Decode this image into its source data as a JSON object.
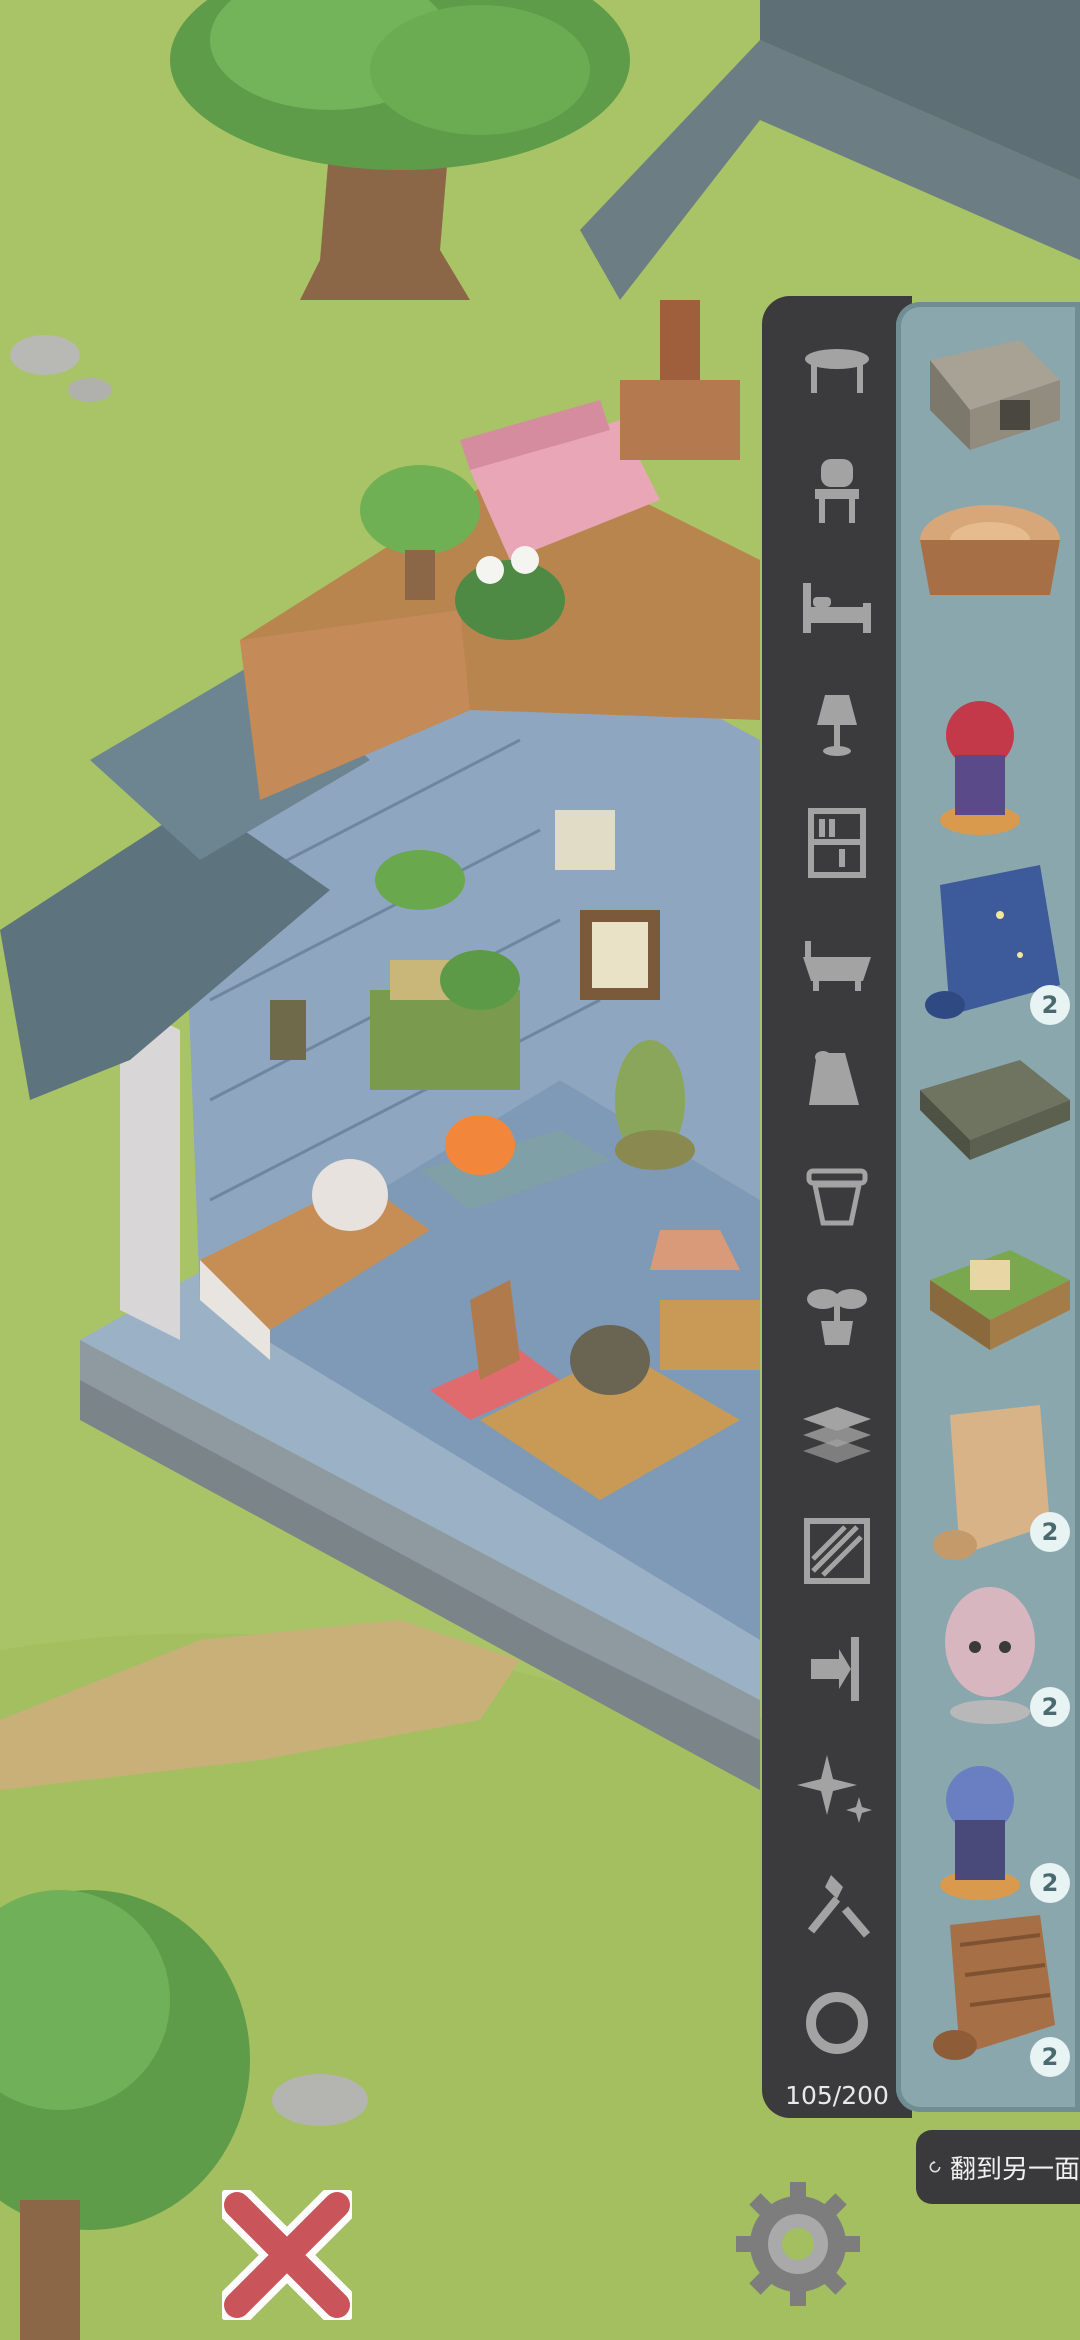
{
  "categories": [
    {
      "id": "table",
      "icon": "table-icon"
    },
    {
      "id": "chair",
      "icon": "chair-icon"
    },
    {
      "id": "bed",
      "icon": "bed-icon"
    },
    {
      "id": "lamp",
      "icon": "lamp-icon"
    },
    {
      "id": "shelf",
      "icon": "bookshelf-icon"
    },
    {
      "id": "bath",
      "icon": "bathtub-icon"
    },
    {
      "id": "rug",
      "icon": "rug-icon"
    },
    {
      "id": "pot",
      "icon": "flowerpot-icon"
    },
    {
      "id": "plant",
      "icon": "plant-icon"
    },
    {
      "id": "floor",
      "icon": "floor-planks-icon"
    },
    {
      "id": "wall",
      "icon": "wallpaper-icon"
    },
    {
      "id": "door",
      "icon": "door-icon"
    },
    {
      "id": "decor",
      "icon": "sparkle-icon"
    },
    {
      "id": "tool",
      "icon": "tools-icon"
    },
    {
      "id": "special",
      "icon": "ring-icon"
    }
  ],
  "inventory": {
    "count": "105/200",
    "items": [
      {
        "name": "stone-stove",
        "qty": ""
      },
      {
        "name": "tree-stump",
        "qty": ""
      },
      {
        "name": "red-figurine",
        "qty": ""
      },
      {
        "name": "starry-scroll",
        "qty": "2"
      },
      {
        "name": "low-table",
        "qty": ""
      },
      {
        "name": "planter-box",
        "qty": ""
      },
      {
        "name": "parchment-scroll",
        "qty": "2"
      },
      {
        "name": "squid-figurine",
        "qty": "2"
      },
      {
        "name": "blue-figurine",
        "qty": "2"
      },
      {
        "name": "wood-scroll",
        "qty": "2"
      }
    ]
  },
  "flip_button": {
    "label": "翻到另一面"
  },
  "colors": {
    "grass": "#a9c466",
    "panel_dark": "#3b3b3d",
    "panel_item": "#8aa7ad",
    "close_red": "#c9545a"
  }
}
